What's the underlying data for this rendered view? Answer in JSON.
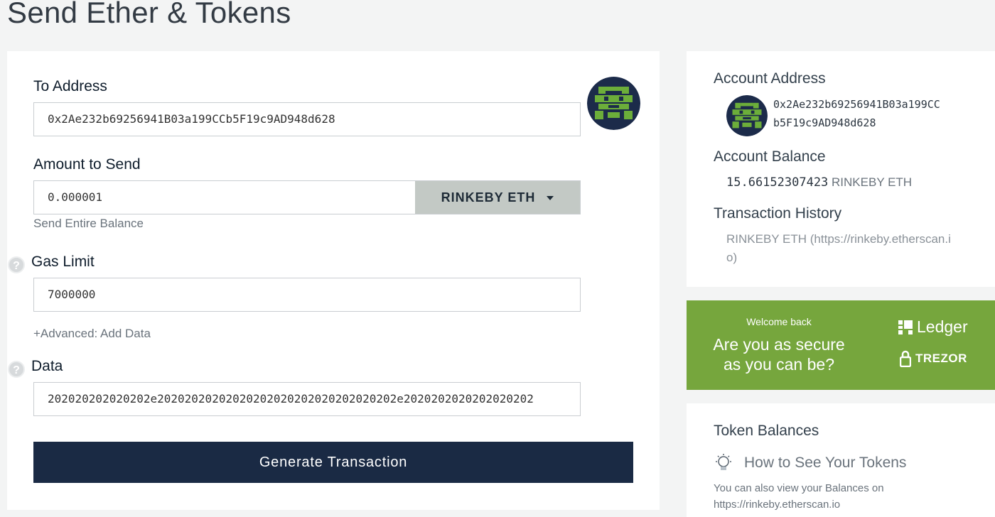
{
  "page": {
    "title": "Send Ether & Tokens"
  },
  "form": {
    "to_address_label": "To Address",
    "to_address_value": "0x2Ae232b69256941B03a199CCb5F19c9AD948d628",
    "amount_label": "Amount to Send",
    "amount_value": "0.000001",
    "unit": "RINKEBY ETH",
    "send_entire_balance": "Send Entire Balance",
    "gas_limit_label": "Gas Limit",
    "gas_limit_value": "7000000",
    "advanced_link": "+Advanced: Add Data",
    "data_label": "Data",
    "data_value": "202020202020202e20202020202020202020202020202020202e2020202020202020202",
    "generate_button": "Generate Transaction",
    "help_icon": "?"
  },
  "account": {
    "address_heading": "Account Address",
    "address_line1": "0x2Ae232b69256941B03a199CC",
    "address_line2": "b5F19c9AD948d628",
    "balance_heading": "Account Balance",
    "balance_value": "15.66152307423",
    "balance_unit": "RINKEBY ETH",
    "history_heading": "Transaction History",
    "history_line1": "RINKEBY ETH (https://rinkeby.etherscan.i",
    "history_line2": "o)"
  },
  "promo": {
    "welcome": "Welcome back",
    "line1": "Are you as secure",
    "line2": "as you can be?",
    "ledger": "Ledger",
    "trezor": "TREZOR"
  },
  "tokens": {
    "heading": "Token Balances",
    "how_to": "How to See Your Tokens",
    "note_line1": "You can also view your Balances on",
    "note_line2": "https://rinkeby.etherscan.io"
  },
  "colors": {
    "primary_button": "#1a2a44",
    "promo_green": "#76a63d",
    "identicon_green": "#6cae3a",
    "identicon_dark": "#1c2b4a"
  }
}
